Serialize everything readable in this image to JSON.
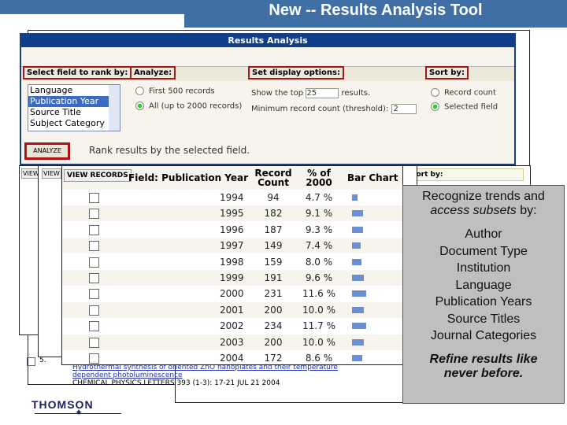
{
  "slide": {
    "title": "New -- Results Analysis Tool",
    "logo": "THOMSON"
  },
  "panel": {
    "title": "Results Analysis",
    "rank_label": "Select field to rank by:",
    "rank_options": [
      "Language",
      "Publication Year",
      "Source Title",
      "Subject Category"
    ],
    "rank_selected": "Publication Year",
    "analyze_label": "Analyze:",
    "analyze_options": [
      "First 500 records",
      "All (up to 2000 records)"
    ],
    "analyze_selected": "All (up to 2000 records)",
    "display_label": "Set display options:",
    "show_top_prefix": "Show the top",
    "show_top_value": "25",
    "show_top_suffix": "results.",
    "threshold_label": "Minimum record count (threshold):",
    "threshold_value": "2",
    "sort_label": "Sort by:",
    "sort_options": [
      "Record count",
      "Selected field"
    ],
    "sort_selected": "Selected field",
    "analyze_button": "ANALYZE",
    "analyze_hint": "Rank results by the selected field."
  },
  "table": {
    "view_records": "VIEW RECORDS",
    "view_short1": "VIEW",
    "view_short2": "VIEW",
    "headers": {
      "field": "Field: Publication Year",
      "count": "Record Count",
      "pct": "% of 2000",
      "bar": "Bar Chart"
    },
    "behind_sort": "Sort by:",
    "rows": [
      {
        "year": "1994",
        "count": 94,
        "pct": "4.7 %"
      },
      {
        "year": "1995",
        "count": 182,
        "pct": "9.1 %"
      },
      {
        "year": "1996",
        "count": 187,
        "pct": "9.3 %"
      },
      {
        "year": "1997",
        "count": 149,
        "pct": "7.4 %"
      },
      {
        "year": "1998",
        "count": 159,
        "pct": "8.0 %"
      },
      {
        "year": "1999",
        "count": 191,
        "pct": "9.6 %"
      },
      {
        "year": "2000",
        "count": 231,
        "pct": "11.6 %"
      },
      {
        "year": "2001",
        "count": 200,
        "pct": "10.0 %"
      },
      {
        "year": "2002",
        "count": 234,
        "pct": "11.7 %"
      },
      {
        "year": "2003",
        "count": 200,
        "pct": "10.0 %"
      },
      {
        "year": "2004",
        "count": 172,
        "pct": "8.6 %"
      }
    ],
    "bar_color": "#6b8fd0"
  },
  "record": {
    "number": "5.",
    "title_line1": "Hydrothermal synthesis of oriented ZnO nanoplates and their temperature",
    "title_line2": "dependent photoluminescence",
    "source": "CHEMICAL PHYSICS LETTERS 393 (1-3): 17-21 JUL 21 2004"
  },
  "callout": {
    "intro1": "Recognize trends and",
    "intro2a": "access subsets",
    "intro2b": " by:",
    "items": [
      "Author",
      "Document Type",
      "Institution",
      "Language",
      "Publication Years",
      "Source Titles",
      "Journal Categories"
    ],
    "outro": "Refine results like never before."
  }
}
